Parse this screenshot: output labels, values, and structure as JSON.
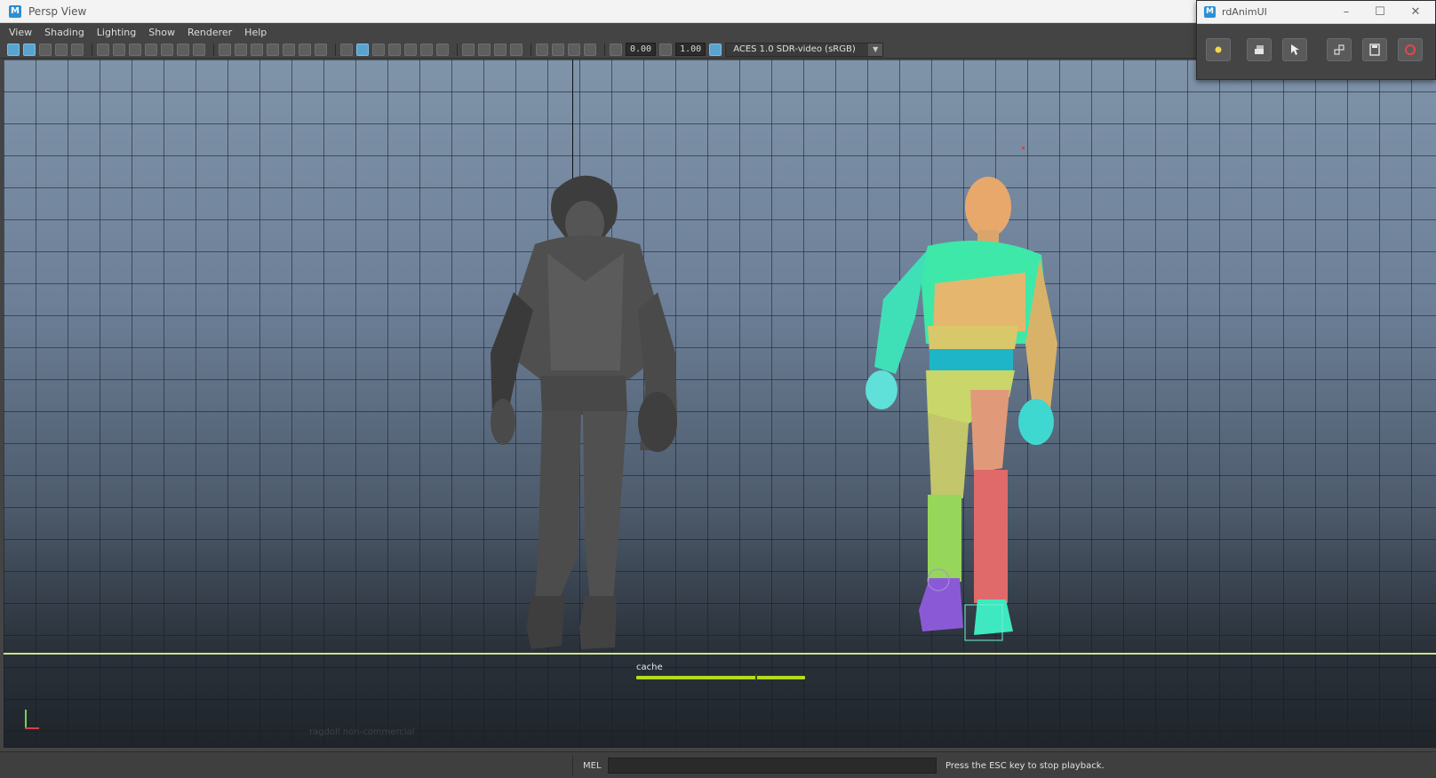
{
  "window": {
    "title": "Persp View",
    "app_icon": "maya-icon"
  },
  "menu": {
    "items": [
      "View",
      "Shading",
      "Lighting",
      "Show",
      "Renderer",
      "Help"
    ]
  },
  "toolbar": {
    "exposure": "0.00",
    "gamma": "1.00",
    "color_space": "ACES 1.0 SDR-video (sRGB)"
  },
  "viewport": {
    "cache_label": "cache",
    "cache_progress": 1.0,
    "watermark": "ragdoll non-commercial",
    "colors": {
      "background_top": "#7f93a9",
      "background_bottom": "#1f242a",
      "ground_line": "#cfe28a",
      "cache_bar": "#b4dc1e"
    }
  },
  "status": {
    "mel_label": "MEL",
    "message": "Press the ESC key to stop playback."
  },
  "anim_window": {
    "title": "rdAnimUI",
    "buttons": [
      {
        "name": "marker-button",
        "icon": "yellow-dot-icon",
        "color": "#f0d84a"
      },
      {
        "name": "layers-button",
        "icon": "stack-icon"
      },
      {
        "name": "select-button",
        "icon": "cursor-icon"
      },
      {
        "name": "pose-button",
        "icon": "link-icon"
      },
      {
        "name": "save-button",
        "icon": "save-icon"
      },
      {
        "name": "record-button",
        "icon": "record-icon",
        "color": "#e54646"
      }
    ]
  }
}
